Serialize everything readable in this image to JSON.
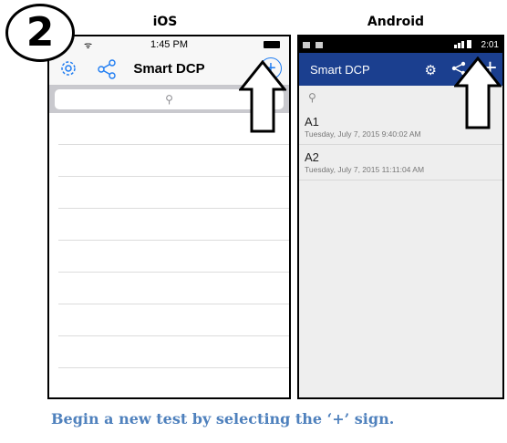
{
  "step": {
    "number": "2"
  },
  "labels": {
    "ios": "iOS",
    "android": "Android"
  },
  "ios": {
    "status_time": "1:45 PM",
    "wifi_glyph": "ᯤ",
    "title": "Smart DCP",
    "icons": {
      "settings": "gear-icon",
      "share": "share-icon",
      "add": "plus-circle-icon",
      "search": "search-icon"
    },
    "add_glyph": "+",
    "search_glyph": "⚲",
    "accent": "#1e7cf2",
    "row_count": 10
  },
  "android": {
    "status_time": "2:01",
    "title": "Smart DCP",
    "accent": "#1b3f8f",
    "gear_glyph": "⚙",
    "add_glyph": "+",
    "search_glyph": "⚲",
    "items": [
      {
        "name": "A1",
        "date": "Tuesday, July 7, 2015 9:40:02 AM"
      },
      {
        "name": "A2",
        "date": "Tuesday, July 7, 2015 11:11:04 AM"
      }
    ]
  },
  "caption": "Begin a new test by selecting the ‘+’ sign.",
  "caption_color": "#4f81bd"
}
